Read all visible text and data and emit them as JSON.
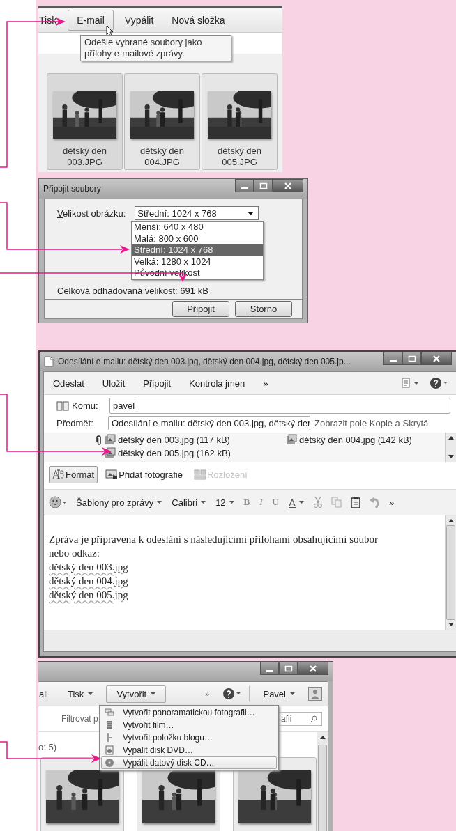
{
  "explorer_top": {
    "toolbar": [
      {
        "label": "Tisk",
        "hovered": false
      },
      {
        "label": "E-mail",
        "hovered": true
      },
      {
        "label": "Vypálit",
        "hovered": false
      },
      {
        "label": "Nová složka",
        "hovered": false
      }
    ],
    "tooltip": "Odešle vybrané soubory jako přílohy e-mailové zprávy.",
    "thumbnails": [
      {
        "caption": "dětský den 003.JPG",
        "selected": true,
        "kind": "picture"
      },
      {
        "caption": "dětský den 004.JPG",
        "selected": true,
        "kind": "picture"
      },
      {
        "caption": "dětský den 005.JPG",
        "selected": true,
        "kind": "picture"
      }
    ]
  },
  "attach_dialog": {
    "title": "Připojit soubory",
    "size_label": "Velikost obrázku:",
    "size_value": "Střední: 1024 x 768",
    "size_options": [
      {
        "label": "Menší: 640 x 480",
        "selected": false
      },
      {
        "label": "Malá: 800 x 600",
        "selected": false
      },
      {
        "label": "Střední: 1024 x 768",
        "selected": true
      },
      {
        "label": "Velká: 1280 x 1024",
        "selected": false
      },
      {
        "label": "Původní velikost",
        "selected": false
      }
    ],
    "total": "Celková odhadovaná velikost: 691 kB",
    "buttons": [
      "Připojit",
      "Storno"
    ]
  },
  "email": {
    "title": "Odesílání e-mailu: dětský den 003.jpg, dětský den 004.jpg, dětský den 005.jp...",
    "toolbar": [
      "Odeslat",
      "Uložit",
      "Připojit",
      "Kontrola jmen",
      "»"
    ],
    "to_label": "Komu:",
    "to_value": "pavel",
    "subject_label": "Předmět:",
    "subject_value": "Odesílání e-mailu: dětský den 003.jpg, dětský der",
    "cc_link": "Zobrazit pole Kopie a Skrytá",
    "attachments": [
      "dětský den 003.jpg (117 kB)",
      "dětský den 004.jpg (142 kB)",
      "dětský den 005.jpg (162 kB)"
    ],
    "insert_bar": [
      {
        "label": "Formát",
        "pressed": true,
        "disabled": false
      },
      {
        "label": "Přidat fotografie",
        "pressed": false,
        "disabled": false
      },
      {
        "label": "Rozložení",
        "pressed": false,
        "disabled": true
      }
    ],
    "format_bar": [
      {
        "kind": "dropdown",
        "label": "Šablony pro zprávy"
      },
      {
        "kind": "dropdown",
        "label": "Calibri"
      },
      {
        "kind": "dropdown",
        "label": "12"
      },
      {
        "kind": "bold",
        "label": "B"
      },
      {
        "kind": "italic",
        "label": "I"
      },
      {
        "kind": "underline",
        "label": "U"
      },
      {
        "kind": "color",
        "label": "A"
      },
      {
        "kind": "more",
        "label": "»"
      }
    ],
    "body": [
      "Zpráva je připravena k odeslání s následujícími přílohami obsahujícími soubor nebo odkaz:",
      "dětský den 003.jpg",
      "dětský den 004.jpg",
      "dětský den 005.jpg"
    ]
  },
  "explorer_bottom": {
    "toolbar": [
      {
        "label": "ail",
        "dropdown": false,
        "open": false
      },
      {
        "label": "Tisk",
        "dropdown": true,
        "open": false
      },
      {
        "label": "Vytvořit",
        "dropdown": true,
        "open": true
      }
    ],
    "more": "»",
    "user": "Pavel",
    "search_left": "Filtrovat p",
    "search_right": "afii",
    "count": "o: 5)",
    "menu": [
      {
        "label": "Vytvořit panoramatickou fotografii…",
        "selected": false
      },
      {
        "label": "Vytvořit film…",
        "selected": false
      },
      {
        "label": "Vytvořit položku blogu…",
        "selected": false
      },
      {
        "label": "Vypálit disk DVD…",
        "selected": false
      },
      {
        "label": "Vypálit datový disk CD…",
        "selected": true
      }
    ]
  }
}
